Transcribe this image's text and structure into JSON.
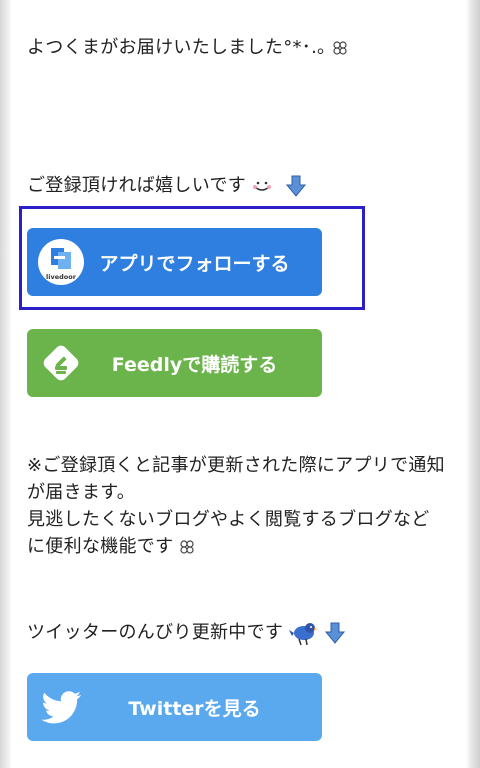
{
  "messages": {
    "delivered": "よつくまがお届けいたしました°*･.｡",
    "please_subscribe": "ご登録頂ければ嬉しいです",
    "notice_line1": "※ご登録頂くと記事が更新された際にアプリで通知",
    "notice_line2": "が届きます。",
    "notice_line3": "見逃したくないブログやよく閲覧するブログなど",
    "notice_line4": "に便利な機能です",
    "twitter_intro": "ツイッターのんびり更新中です"
  },
  "buttons": {
    "app_follow": "アプリでフォローする",
    "app_logo_text": "livedoor",
    "feedly": "Feedlyで購読する",
    "twitter": "Twitterを見る"
  },
  "colors": {
    "app_button": "#2f7fe0",
    "feedly_button": "#6bb34b",
    "twitter_button": "#5aa8ee",
    "highlight_border": "#2b1fc7"
  },
  "icons": [
    "clover-icon",
    "smile-face-icon",
    "down-arrow-icon",
    "livedoor-app-icon",
    "feedly-icon",
    "bird-icon",
    "twitter-bird-icon"
  ]
}
